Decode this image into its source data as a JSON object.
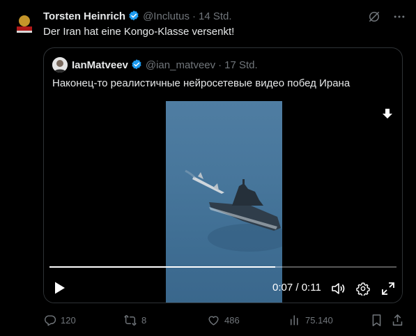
{
  "tweet": {
    "author_name": "Torsten Heinrich",
    "handle": "@Inclutus",
    "separator": "·",
    "age": "14 Std.",
    "text": "Der Iran hat eine Kongo-Klasse versenkt!"
  },
  "quoted": {
    "author_name": "IanMatveev",
    "handle": "@ian_matveev",
    "separator": "·",
    "age": "17 Std.",
    "text": "Наконец-то реалистичные нейросетевые видео побед Ирана"
  },
  "video": {
    "current_time": "0:07",
    "time_separator": " / ",
    "duration": "0:11",
    "progress": 0.65
  },
  "actions": {
    "replies": "120",
    "reposts": "8",
    "likes": "486",
    "views": "75.140"
  },
  "colors": {
    "background": "#000000",
    "text": "#e7e9ea",
    "muted": "#71767b",
    "verified": "#1d9bf0",
    "border": "#2f3336"
  }
}
